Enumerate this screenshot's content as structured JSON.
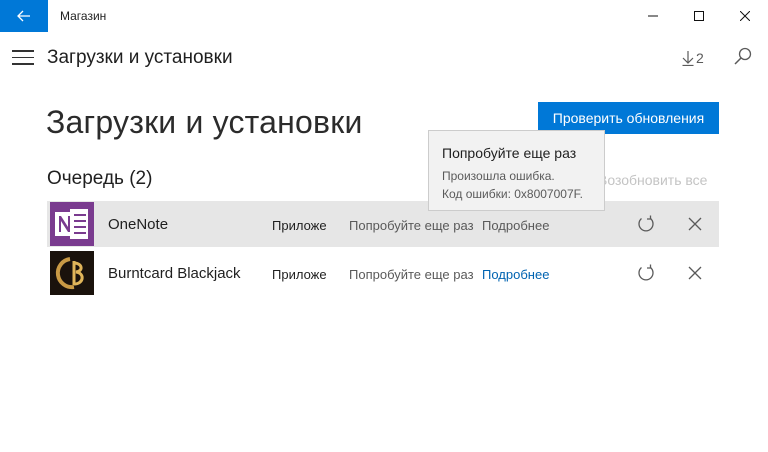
{
  "window": {
    "title": "Магазин",
    "accent": "#0078d7"
  },
  "header": {
    "title": "Загрузки и установки",
    "downloads_count": "2"
  },
  "main": {
    "page_title": "Загрузки и установки",
    "check_updates_label": "Проверить обновления",
    "queue_label": "Очередь (2)",
    "resume_all_label": "Возобновить все"
  },
  "queue": [
    {
      "name": "OneNote",
      "type": "Приложе",
      "status": "Попробуйте еще раз",
      "details_label": "Подробнее",
      "icon": "onenote-icon"
    },
    {
      "name": "Burntcard Blackjack",
      "type": "Приложе",
      "status": "Попробуйте еще раз",
      "details_label": "Подробнее",
      "icon": "burntcard-blackjack-icon"
    }
  ],
  "tooltip": {
    "title": "Попробуйте еще раз",
    "line1": "Произошла ошибка.",
    "line2": "Код ошибки: 0x8007007F."
  }
}
